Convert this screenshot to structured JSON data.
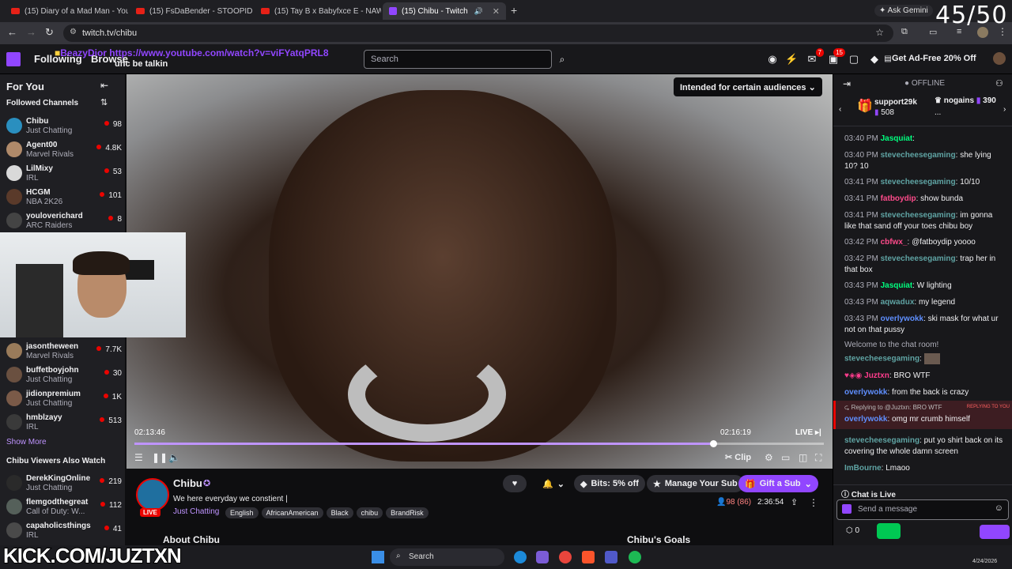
{
  "browser": {
    "tabs": [
      {
        "label": "(15) Diary of a Mad Man - YouT"
      },
      {
        "label": "(15) FsDaBender - STOOPID (Of"
      },
      {
        "label": "(15) Tay B x Babyfxce E - NAWl"
      },
      {
        "label": "(15) Chibu - Twitch"
      }
    ],
    "ask_gemini": "Ask Gemini",
    "url": "twitch.tv/chibu"
  },
  "overlay": {
    "counter": "45/50",
    "donation_user": "BeazyDior",
    "donation_url": "https://www.youtube.com/watch?v=viFYatqPRL8",
    "donation_sub": "unc be talkin",
    "kick_text": "KICK.COM/JUZTXN"
  },
  "topnav": {
    "following": "Following",
    "browse": "Browse",
    "search_placeholder": "Search",
    "badge_1": "7",
    "badge_2": "15",
    "ad_free": "Get Ad-Free 20% Off"
  },
  "sidebar": {
    "for_you": "For You",
    "followed": "Followed Channels",
    "channels": [
      {
        "name": "Chibu",
        "game": "Just Chatting",
        "viewers": "98"
      },
      {
        "name": "Agent00",
        "game": "Marvel Rivals",
        "viewers": "4.8K"
      },
      {
        "name": "LilMixy",
        "game": "IRL",
        "viewers": "53"
      },
      {
        "name": "HCGM",
        "game": "NBA 2K26",
        "viewers": "101"
      },
      {
        "name": "youloverichard",
        "game": "ARC Raiders",
        "viewers": "8"
      },
      {
        "name": "jasontheween",
        "game": "Marvel Rivals",
        "viewers": "7.7K"
      },
      {
        "name": "buffetboyjohn",
        "game": "Just Chatting",
        "viewers": "30"
      },
      {
        "name": "jidionpremium",
        "game": "Just Chatting",
        "viewers": "1K"
      },
      {
        "name": "hmblzayy",
        "game": "IRL",
        "viewers": "513"
      }
    ],
    "show_more": "Show More",
    "also_watch": "Chibu Viewers Also Watch",
    "also": [
      {
        "name": "DerekKingOnline",
        "game": "Just Chatting",
        "viewers": "219"
      },
      {
        "name": "flemgodthegreat",
        "game": "Call of Duty: W...",
        "viewers": "112"
      },
      {
        "name": "capaholicsthings",
        "game": "IRL",
        "viewers": "41"
      }
    ]
  },
  "player": {
    "audience": "Intended for certain audiences",
    "time_left": "02:13:46",
    "time_right": "02:16:19",
    "live": "LIVE",
    "clip": "Clip",
    "progress": 0.84
  },
  "info": {
    "streamer": "Chibu",
    "title": "We here everyday we constient |",
    "live_badge": "LIVE",
    "category": "Just Chatting",
    "tags": [
      "English",
      "AfricanAmerican",
      "Black",
      "chibu",
      "BrandRisk"
    ],
    "bits": "Bits: 5% off",
    "manage_sub": "Manage Your Sub",
    "gift_sub": "Gift a Sub",
    "viewers": "98 (86)",
    "uptime": "2:36:54",
    "about": "About Chibu",
    "goals": "Chibu's Goals"
  },
  "chat": {
    "status": "OFFLINE",
    "gifters": [
      {
        "name": "support29k",
        "count": "508"
      },
      {
        "name": "nogains",
        "count": "390"
      }
    ],
    "gifter_more": "...",
    "messages": [
      {
        "time": "03:40 PM",
        "user": "Jasquiat",
        "color": "#00ff7f",
        "text": ""
      },
      {
        "time": "03:40 PM",
        "user": "stevecheesegaming",
        "color": "#5fa3a3",
        "text": "she lying 10? 10"
      },
      {
        "time": "03:41 PM",
        "user": "stevecheesegaming",
        "color": "#5fa3a3",
        "text": "10/10"
      },
      {
        "time": "03:41 PM",
        "user": "fatboydip",
        "color": "#ff4b8b",
        "text": "show bunda"
      },
      {
        "time": "03:41 PM",
        "user": "stevecheesegaming",
        "color": "#5fa3a3",
        "text": "im gonna like that sand off your toes chibu boy"
      },
      {
        "time": "03:42 PM",
        "user": "cbfwx_",
        "color": "#ff4b8b",
        "text": "@fatboydip yoooo"
      },
      {
        "time": "03:42 PM",
        "user": "stevecheesegaming",
        "color": "#5fa3a3",
        "text": "trap her in that box"
      },
      {
        "time": "03:43 PM",
        "user": "Jasquiat",
        "color": "#00ff7f",
        "text": "W lighting"
      },
      {
        "time": "03:43 PM",
        "user": "aqwadux",
        "color": "#5fa3a3",
        "text": "my legend"
      },
      {
        "time": "03:43 PM",
        "user": "overlywokk",
        "color": "#5f8fff",
        "text": "ski mask for what ur not on that pussy"
      }
    ],
    "welcome": "Welcome to the chat room!",
    "m_steve": "stevecheesegaming",
    "m_juztxn_user": "Juztxn",
    "m_juztxn_text": "BRO WTF",
    "m_overly1_user": "overlywokk",
    "m_overly1_text": "from the back is crazy",
    "reply_to": "Replying to @Juztxn: BRO WTF",
    "replying_badge": "REPLYING TO YOU",
    "m_overly2_user": "overlywokk",
    "m_overly2_text": "omg mr crumb himself",
    "m_steve2_user": "stevecheesegaming",
    "m_steve2_text": "put yo shirt back on its covering the whole damn screen",
    "m_bourne_user": "ImBourne",
    "m_bourne_text": "Lmaoo",
    "chat_live": "Chat is Live",
    "send_placeholder": "Send a message",
    "points": "0"
  },
  "taskbar": {
    "search": "Search",
    "date": "4/24/2026"
  }
}
